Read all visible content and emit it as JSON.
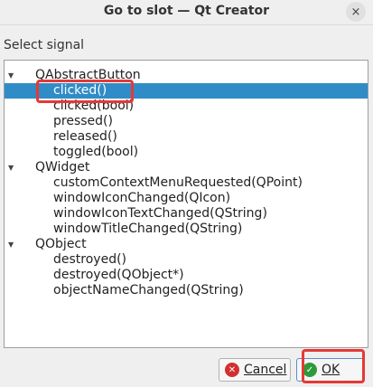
{
  "window": {
    "title": "Go to slot — Qt Creator",
    "close_icon": "×"
  },
  "section_label": "Select signal",
  "tree": {
    "groups": [
      {
        "label": "QAbstractButton",
        "expanded": true,
        "items": [
          "clicked()",
          "clicked(bool)",
          "pressed()",
          "released()",
          "toggled(bool)"
        ]
      },
      {
        "label": "QWidget",
        "expanded": true,
        "items": [
          "customContextMenuRequested(QPoint)",
          "windowIconChanged(QIcon)",
          "windowIconTextChanged(QString)",
          "windowTitleChanged(QString)"
        ]
      },
      {
        "label": "QObject",
        "expanded": true,
        "items": [
          "destroyed()",
          "destroyed(QObject*)",
          "objectNameChanged(QString)"
        ]
      }
    ],
    "selected_item": "clicked()"
  },
  "buttons": {
    "cancel": {
      "label": "Cancel",
      "underline_char": "C"
    },
    "ok": {
      "label": "OK",
      "underline_char": "O"
    }
  },
  "colors": {
    "selection": "#308cc6",
    "highlight_annotation": "#e53935"
  },
  "icons": {
    "expand": "down-triangle-icon",
    "cancel": "cancel-circle-icon",
    "ok": "ok-check-circle-icon"
  }
}
